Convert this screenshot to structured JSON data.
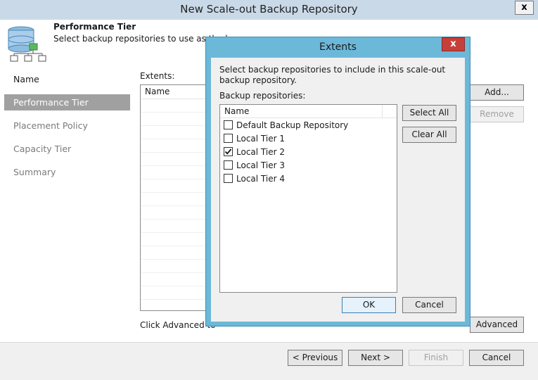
{
  "window": {
    "title": "New Scale-out Backup Repository",
    "close_glyph": "x"
  },
  "header": {
    "title": "Performance Tier",
    "subtitle": "Select backup repositories to use as the la"
  },
  "sidebar": {
    "items": [
      {
        "label": "Name"
      },
      {
        "label": "Performance Tier"
      },
      {
        "label": "Placement Policy"
      },
      {
        "label": "Capacity Tier"
      },
      {
        "label": "Summary"
      }
    ],
    "active_index": 1
  },
  "main": {
    "extents_label": "Extents:",
    "column_name": "Name",
    "add_button": "Add...",
    "remove_button": "Remove",
    "advanced_hint": "Click Advanced to",
    "advanced_button": "Advanced"
  },
  "footer": {
    "previous": "< Previous",
    "next": "Next >",
    "finish": "Finish",
    "cancel": "Cancel"
  },
  "dialog": {
    "title": "Extents",
    "close_glyph": "x",
    "description": "Select backup repositories to include in this scale-out backup repository.",
    "list_label": "Backup repositories:",
    "column_name": "Name",
    "repositories": [
      {
        "name": "Default Backup Repository",
        "checked": false
      },
      {
        "name": "Local Tier 1",
        "checked": false
      },
      {
        "name": "Local Tier 2",
        "checked": true
      },
      {
        "name": "Local Tier 3",
        "checked": false
      },
      {
        "name": "Local Tier 4",
        "checked": false
      }
    ],
    "select_all": "Select All",
    "clear_all": "Clear All",
    "ok": "OK",
    "cancel": "Cancel"
  },
  "colors": {
    "dialog_frame": "#6cb8d9",
    "dialog_close": "#c6403a",
    "active_nav": "#a0a0a0",
    "titlebar": "#c9d9e8"
  }
}
